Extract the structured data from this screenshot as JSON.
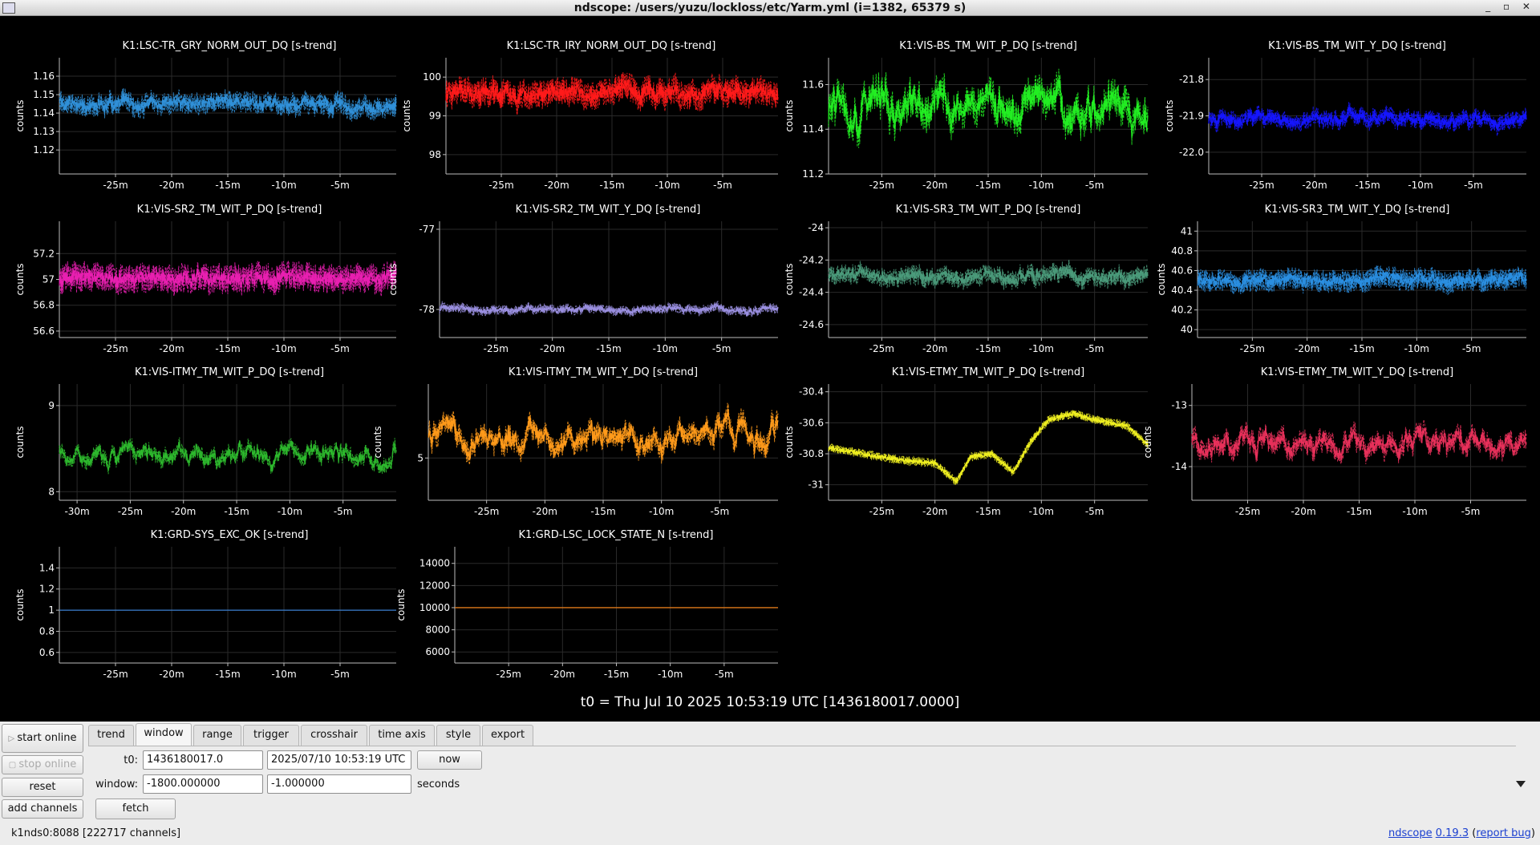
{
  "window": {
    "title": "ndscope: /users/yuzu/lockloss/etc/Yarm.yml (i=1382, 65379 s)"
  },
  "t0_label": "t0 = Thu Jul 10 2025 10:53:19 UTC [1436180017.0000]",
  "chart_data": [
    {
      "type": "line",
      "title": "K1:LSC-TR_GRY_NORM_OUT_DQ [s-trend]",
      "ylabel": "counts",
      "color": "#3090d8",
      "xmin": -1800,
      "xmax": 0,
      "ylim": [
        1.107,
        1.17
      ],
      "yticks": [
        1.12,
        1.13,
        1.14,
        1.15,
        1.16
      ],
      "ytick_labels": [
        "1.12",
        "1.13",
        "1.14",
        "1.15",
        "1.16"
      ],
      "xticks": [
        -1500,
        -1200,
        -900,
        -600,
        -300
      ],
      "xtick_labels": [
        "-25m",
        "-20m",
        "-15m",
        "-10m",
        "-5m"
      ],
      "center": 1.145,
      "noise": 0.01,
      "wander": 0.001,
      "grid": true
    },
    {
      "type": "line",
      "title": "K1:LSC-TR_IRY_NORM_OUT_DQ [s-trend]",
      "ylabel": "counts",
      "color": "#ff1a1a",
      "xmin": -1800,
      "xmax": 0,
      "ylim": [
        97.5,
        100.5
      ],
      "yticks": [
        98,
        99,
        100
      ],
      "ytick_labels": [
        "98",
        "99",
        "100"
      ],
      "xticks": [
        -1500,
        -1200,
        -900,
        -600,
        -300
      ],
      "xtick_labels": [
        "-25m",
        "-20m",
        "-15m",
        "-10m",
        "-5m"
      ],
      "center": 99.6,
      "noise": 0.65,
      "wander": 0.05,
      "grid": true
    },
    {
      "type": "line",
      "title": "K1:VIS-BS_TM_WIT_P_DQ [s-trend]",
      "ylabel": "counts",
      "color": "#22ee22",
      "xmin": -1800,
      "xmax": 0,
      "ylim": [
        11.2,
        11.72
      ],
      "yticks": [
        11.2,
        11.4,
        11.6
      ],
      "ytick_labels": [
        "11.2",
        "11.4",
        "11.6"
      ],
      "xticks": [
        -1500,
        -1200,
        -900,
        -600,
        -300
      ],
      "xtick_labels": [
        "-25m",
        "-20m",
        "-15m",
        "-10m",
        "-5m"
      ],
      "center": 11.5,
      "noise": 0.12,
      "wander": 0.03,
      "grid": true
    },
    {
      "type": "line",
      "title": "K1:VIS-BS_TM_WIT_Y_DQ [s-trend]",
      "ylabel": "counts",
      "color": "#1515ff",
      "xmin": -1800,
      "xmax": 0,
      "ylim": [
        -22.06,
        -21.74
      ],
      "yticks": [
        -22.0,
        -21.9,
        -21.8
      ],
      "ytick_labels": [
        "-22.0",
        "-21.9",
        "-21.8"
      ],
      "xticks": [
        -1500,
        -1200,
        -900,
        -600,
        -300
      ],
      "xtick_labels": [
        "-25m",
        "-20m",
        "-15m",
        "-10m",
        "-5m"
      ],
      "center": -21.91,
      "noise": 0.04,
      "wander": 0.005,
      "grid": true
    },
    {
      "type": "line",
      "title": "K1:VIS-SR2_TM_WIT_P_DQ [s-trend]",
      "ylabel": "counts",
      "color": "#e81fb0",
      "xmin": -1800,
      "xmax": 0,
      "ylim": [
        56.55,
        57.45
      ],
      "yticks": [
        56.6,
        56.8,
        57,
        57.2
      ],
      "ytick_labels": [
        "56.6",
        "56.8",
        "57",
        "57.2"
      ],
      "xticks": [
        -1500,
        -1200,
        -900,
        -600,
        -300
      ],
      "xtick_labels": [
        "-25m",
        "-20m",
        "-15m",
        "-10m",
        "-5m"
      ],
      "center": 57.0,
      "noise": 0.2,
      "wander": 0.01,
      "grid": true
    },
    {
      "type": "line",
      "title": "K1:VIS-SR2_TM_WIT_Y_DQ [s-trend]",
      "ylabel": "counts",
      "color": "#9a8fe0",
      "xmin": -1800,
      "xmax": 0,
      "ylim": [
        -78.35,
        -76.9
      ],
      "yticks": [
        -78,
        -77
      ],
      "ytick_labels": [
        "-78",
        "-77"
      ],
      "xticks": [
        -1500,
        -1200,
        -900,
        -600,
        -300
      ],
      "xtick_labels": [
        "-25m",
        "-20m",
        "-15m",
        "-10m",
        "-5m"
      ],
      "center": -78.0,
      "noise": 0.1,
      "wander": 0.01,
      "grid": true
    },
    {
      "type": "line",
      "title": "K1:VIS-SR3_TM_WIT_P_DQ [s-trend]",
      "ylabel": "counts",
      "color": "#4a9a7a",
      "xmin": -1800,
      "xmax": 0,
      "ylim": [
        -24.68,
        -23.96
      ],
      "yticks": [
        -24.6,
        -24.4,
        -24.2,
        -24
      ],
      "ytick_labels": [
        "-24.6",
        "-24.4",
        "-24.2",
        "-24"
      ],
      "xticks": [
        -1500,
        -1200,
        -900,
        -600,
        -300
      ],
      "xtick_labels": [
        "-25m",
        "-20m",
        "-15m",
        "-10m",
        "-5m"
      ],
      "center": -24.3,
      "noise": 0.1,
      "wander": 0.01,
      "grid": true
    },
    {
      "type": "line",
      "title": "K1:VIS-SR3_TM_WIT_Y_DQ [s-trend]",
      "ylabel": "counts",
      "color": "#2a8ee0",
      "xmin": -1800,
      "xmax": 0,
      "ylim": [
        39.92,
        41.1
      ],
      "yticks": [
        40,
        40.2,
        40.4,
        40.6,
        40.8,
        41
      ],
      "ytick_labels": [
        "40",
        "40.2",
        "40.4",
        "40.6",
        "40.8",
        "41"
      ],
      "xticks": [
        -1500,
        -1200,
        -900,
        -600,
        -300
      ],
      "xtick_labels": [
        "-25m",
        "-20m",
        "-15m",
        "-10m",
        "-5m"
      ],
      "center": 40.5,
      "noise": 0.2,
      "wander": 0.01,
      "grid": true
    },
    {
      "type": "line",
      "title": "K1:VIS-ITMY_TM_WIT_P_DQ [s-trend]",
      "ylabel": "counts",
      "color": "#2db82d",
      "xmin": -1900,
      "xmax": 0,
      "ylim": [
        7.9,
        9.25
      ],
      "yticks": [
        8,
        9
      ],
      "ytick_labels": [
        "8",
        "9"
      ],
      "xticks": [
        -1800,
        -1500,
        -1200,
        -900,
        -600,
        -300
      ],
      "xtick_labels": [
        "-30m",
        "-25m",
        "-20m",
        "-15m",
        "-10m",
        "-5m"
      ],
      "center": 8.45,
      "noise": 0.13,
      "wander": 0.04,
      "grid": true
    },
    {
      "type": "line",
      "title": "K1:VIS-ITMY_TM_WIT_Y_DQ [s-trend]",
      "ylabel": "counts",
      "color": "#ff9a1a",
      "xmin": -1800,
      "xmax": 0,
      "ylim": [
        4.2,
        6.4
      ],
      "yticks": [
        5
      ],
      "ytick_labels": [
        "5"
      ],
      "xticks": [
        -1500,
        -1200,
        -900,
        -600,
        -300
      ],
      "xtick_labels": [
        "-25m",
        "-20m",
        "-15m",
        "-10m",
        "-5m"
      ],
      "center": 5.4,
      "noise": 0.35,
      "wander": 0.08,
      "grid": true
    },
    {
      "type": "line",
      "title": "K1:VIS-ETMY_TM_WIT_P_DQ [s-trend]",
      "ylabel": "counts",
      "color": "#f0f020",
      "xmin": -1800,
      "xmax": 0,
      "ylim": [
        -31.1,
        -30.35
      ],
      "yticks": [
        -31,
        -30.8,
        -30.6,
        -30.4
      ],
      "ytick_labels": [
        "-31",
        "-30.8",
        "-30.6",
        "-30.4"
      ],
      "xticks": [
        -1500,
        -1200,
        -900,
        -600,
        -300
      ],
      "xtick_labels": [
        "-25m",
        "-20m",
        "-15m",
        "-10m",
        "-5m"
      ],
      "center": -30.75,
      "noise": 0.05,
      "wander": 0.0,
      "grid": true,
      "trend": [
        [
          -1800,
          -30.76
        ],
        [
          -1600,
          -30.8
        ],
        [
          -1400,
          -30.84
        ],
        [
          -1200,
          -30.86
        ],
        [
          -1080,
          -30.98
        ],
        [
          -1000,
          -30.82
        ],
        [
          -880,
          -30.8
        ],
        [
          -760,
          -30.92
        ],
        [
          -660,
          -30.72
        ],
        [
          -560,
          -30.58
        ],
        [
          -420,
          -30.54
        ],
        [
          -300,
          -30.58
        ],
        [
          -120,
          -30.62
        ],
        [
          0,
          -30.74
        ]
      ],
      "grid_on": true
    },
    {
      "type": "line",
      "title": "K1:VIS-ETMY_TM_WIT_Y_DQ [s-trend]",
      "ylabel": "counts",
      "color": "#e8305a",
      "xmin": -1800,
      "xmax": 0,
      "ylim": [
        -14.55,
        -12.65
      ],
      "yticks": [
        -14,
        -13
      ],
      "ytick_labels": [
        "-14",
        "-13"
      ],
      "xticks": [
        -1500,
        -1200,
        -900,
        -600,
        -300
      ],
      "xtick_labels": [
        "-25m",
        "-20m",
        "-15m",
        "-10m",
        "-5m"
      ],
      "center": -13.6,
      "noise": 0.28,
      "wander": 0.06,
      "grid": true
    },
    {
      "type": "line",
      "title": "K1:GRD-SYS_EXC_OK [s-trend]",
      "ylabel": "counts",
      "color": "#3a7ed0",
      "xmin": -1800,
      "xmax": 0,
      "ylim": [
        0.5,
        1.6
      ],
      "yticks": [
        0.6,
        0.8,
        1,
        1.2,
        1.4
      ],
      "ytick_labels": [
        "0.6",
        "0.8",
        "1",
        "1.2",
        "1.4"
      ],
      "xticks": [
        -1500,
        -1200,
        -900,
        -600,
        -300
      ],
      "xtick_labels": [
        "-25m",
        "-20m",
        "-15m",
        "-10m",
        "-5m"
      ],
      "center": 1,
      "noise": 0,
      "wander": 0,
      "grid": true
    },
    {
      "type": "line",
      "title": "K1:GRD-LSC_LOCK_STATE_N [s-trend]",
      "ylabel": "counts",
      "color": "#e07a1a",
      "xmin": -1800,
      "xmax": 0,
      "ylim": [
        5000,
        15500
      ],
      "yticks": [
        6000,
        8000,
        10000,
        12000,
        14000
      ],
      "ytick_labels": [
        "6000",
        "8000",
        "10000",
        "12000",
        "14000"
      ],
      "xticks": [
        -1500,
        -1200,
        -900,
        -600,
        -300
      ],
      "xtick_labels": [
        "-25m",
        "-20m",
        "-15m",
        "-10m",
        "-5m"
      ],
      "center": 10000,
      "noise": 0,
      "wander": 0,
      "grid": true
    }
  ],
  "controls": {
    "start_online": "start online",
    "stop_online": "stop online",
    "reset": "reset",
    "add_channels": "add channels",
    "tabs": [
      "trend",
      "window",
      "range",
      "trigger",
      "crosshair",
      "time axis",
      "style",
      "export"
    ],
    "active_tab": "window",
    "t0_label": "t0:",
    "t0_gps": "1436180017.0",
    "t0_utc": "2025/07/10 10:53:19 UTC",
    "now": "now",
    "window_label": "window:",
    "window_start": "-1800.000000",
    "window_end": "-1.000000",
    "seconds": "seconds",
    "fetch": "fetch"
  },
  "status": {
    "server": "k1nds0:8088  [222717 channels]",
    "app": "ndscope",
    "version": "0.19.3",
    "report": "report bug"
  }
}
